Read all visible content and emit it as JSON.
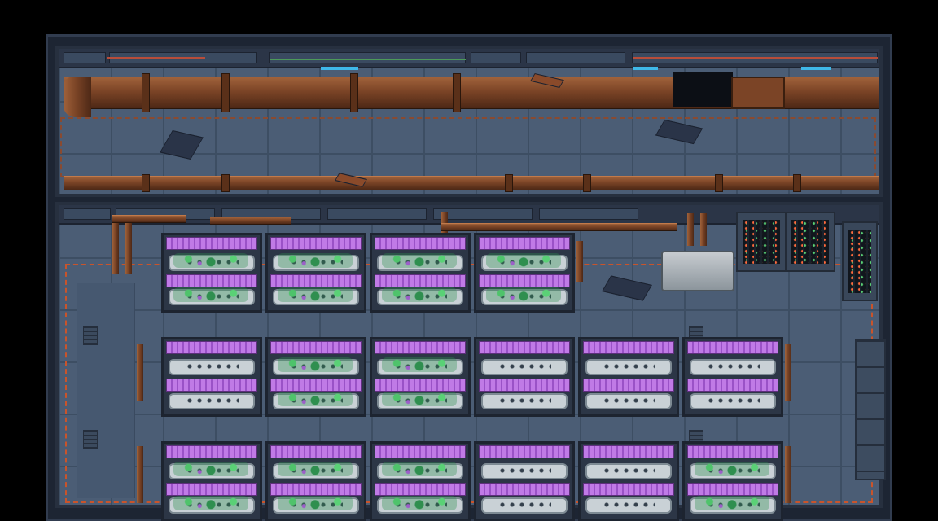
{
  "scene": {
    "description_tags": [
      "hydroponics-bay",
      "corridor",
      "pixel-art",
      "space-station"
    ],
    "colors": {
      "hull": "#1d2533",
      "floor": "#4b5d75",
      "pipe": "#7b4426",
      "grow_light": "#c07ae6",
      "plant": "#4fc36b",
      "hazard_stripe": "#c9542b",
      "tray": "#c9d1d6"
    },
    "rooms": [
      "corridor",
      "hydroponics"
    ],
    "hydroponics": {
      "rows": [
        {
          "bay_count": 4,
          "plants": [
            true,
            true,
            true,
            true
          ]
        },
        {
          "bay_count": 6,
          "plants": [
            false,
            true,
            true,
            false,
            false,
            false
          ]
        },
        {
          "bay_count": 6,
          "plants": [
            true,
            true,
            true,
            false,
            false,
            true
          ]
        }
      ]
    },
    "equipment": [
      "server-rack",
      "server-rack",
      "server-rack",
      "storage-tank"
    ]
  }
}
